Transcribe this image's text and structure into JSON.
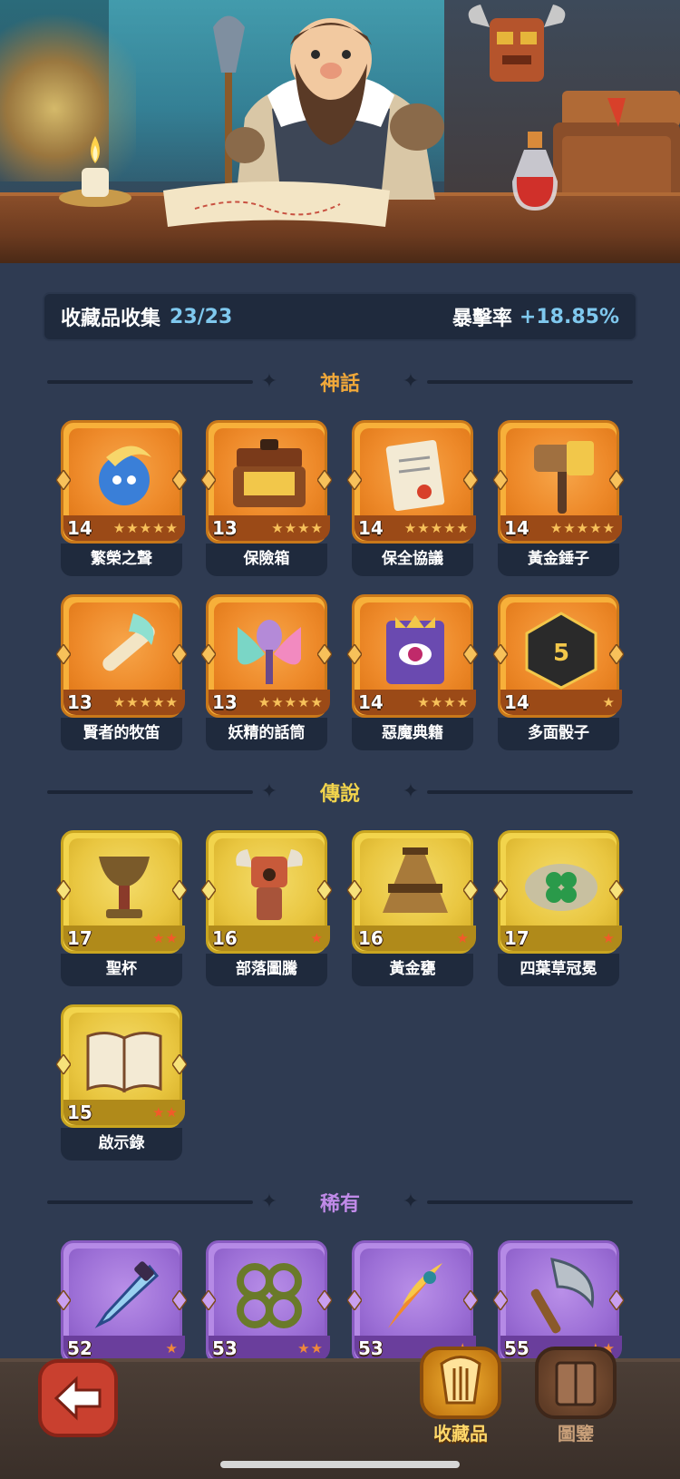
{
  "stats": {
    "collection_label": "收藏品收集",
    "collection_count": "23/23",
    "crit_label": "暴擊率",
    "crit_value": "+18.85%"
  },
  "sections": {
    "mythic": {
      "title": "神話",
      "color": "#f0a83a"
    },
    "legend": {
      "title": "傳說",
      "color": "#f2d44c"
    },
    "rare": {
      "title": "稀有",
      "color": "#c08ae8"
    }
  },
  "mythic_items": [
    {
      "name": "繁榮之聲",
      "level": "14",
      "stars": 5,
      "icon": "blue-spirit-icon"
    },
    {
      "name": "保險箱",
      "level": "13",
      "stars": 4,
      "icon": "gold-safe-icon"
    },
    {
      "name": "保全協議",
      "level": "14",
      "stars": 5,
      "icon": "scroll-contract-icon"
    },
    {
      "name": "黃金錘子",
      "level": "14",
      "stars": 5,
      "icon": "golden-hammer-icon"
    },
    {
      "name": "賢者的牧笛",
      "level": "13",
      "stars": 5,
      "icon": "flute-icon"
    },
    {
      "name": "妖精的話筒",
      "level": "13",
      "stars": 5,
      "icon": "fairy-microphone-icon"
    },
    {
      "name": "惡魔典籍",
      "level": "14",
      "stars": 4,
      "icon": "demon-tome-icon"
    },
    {
      "name": "多面骰子",
      "level": "14",
      "stars": 1,
      "icon": "d20-dice-icon"
    }
  ],
  "legend_items": [
    {
      "name": "聖杯",
      "level": "17",
      "stars": 2,
      "icon": "holy-grail-icon"
    },
    {
      "name": "部落圖騰",
      "level": "16",
      "stars": 1,
      "icon": "tribal-totem-icon"
    },
    {
      "name": "黃金甕",
      "level": "16",
      "stars": 1,
      "icon": "golden-urn-icon"
    },
    {
      "name": "四葉草冠冕",
      "level": "17",
      "stars": 1,
      "icon": "clover-crown-icon"
    },
    {
      "name": "啟示錄",
      "level": "15",
      "stars": 2,
      "icon": "open-book-icon"
    }
  ],
  "rare_items": [
    {
      "level": "52",
      "stars": 1,
      "icon": "ice-dagger-icon"
    },
    {
      "level": "53",
      "stars": 2,
      "icon": "thorn-vine-icon"
    },
    {
      "level": "53",
      "stars": 1,
      "icon": "phoenix-feather-icon"
    },
    {
      "level": "55",
      "stars": 2,
      "icon": "battle-axe-icon"
    }
  ],
  "nav": {
    "collection_label": "收藏品",
    "codex_label": "圖鑒"
  }
}
